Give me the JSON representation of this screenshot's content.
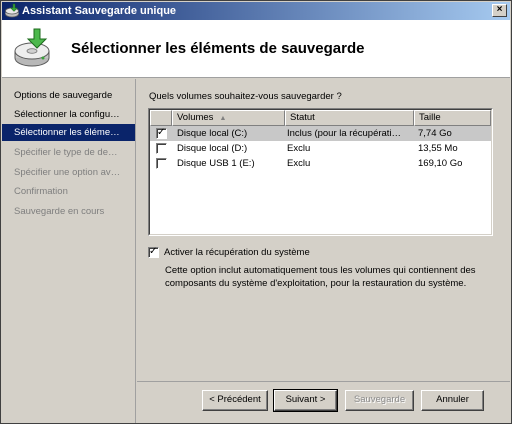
{
  "window": {
    "title": "Assistant Sauvegarde unique",
    "icon": "backup-app-icon",
    "close_glyph": "×"
  },
  "header": {
    "title": "Sélectionner les éléments de sauvegarde",
    "icon": "backup-disk-icon"
  },
  "nav": {
    "items": [
      {
        "label": "Options de sauvegarde",
        "state": "done"
      },
      {
        "label": "Sélectionner la configu…",
        "state": "done"
      },
      {
        "label": "Sélectionner les éléme…",
        "state": "active"
      },
      {
        "label": "Spécifier le type de de…",
        "state": "pending"
      },
      {
        "label": "Spécifier une option av…",
        "state": "pending"
      },
      {
        "label": "Confirmation",
        "state": "pending"
      },
      {
        "label": "Sauvegarde en cours",
        "state": "pending"
      }
    ]
  },
  "main": {
    "question": "Quels volumes souhaitez-vous sauvegarder ?",
    "columns": [
      "Volumes",
      "Statut",
      "Taille"
    ],
    "sort_glyph": "▲",
    "rows": [
      {
        "checked": true,
        "volume": "Disque local (C:)",
        "status": "Inclus (pour la récupérati…",
        "size": "7,74 Go"
      },
      {
        "checked": false,
        "volume": "Disque local (D:)",
        "status": "Exclu",
        "size": "13,55 Mo"
      },
      {
        "checked": false,
        "volume": "Disque USB 1 (E:)",
        "status": "Exclu",
        "size": "169,10 Go"
      }
    ],
    "check_glyph": "✓",
    "recovery_option": {
      "checked": true,
      "label": "Activer la récupération du système",
      "description": "Cette option inclut automatiquement tous les volumes qui contiennent des composants du système d'exploitation, pour la restauration du système."
    }
  },
  "buttons": {
    "previous": "< Précédent",
    "next": "Suivant >",
    "backup": "Sauvegarde",
    "cancel": "Annuler"
  }
}
